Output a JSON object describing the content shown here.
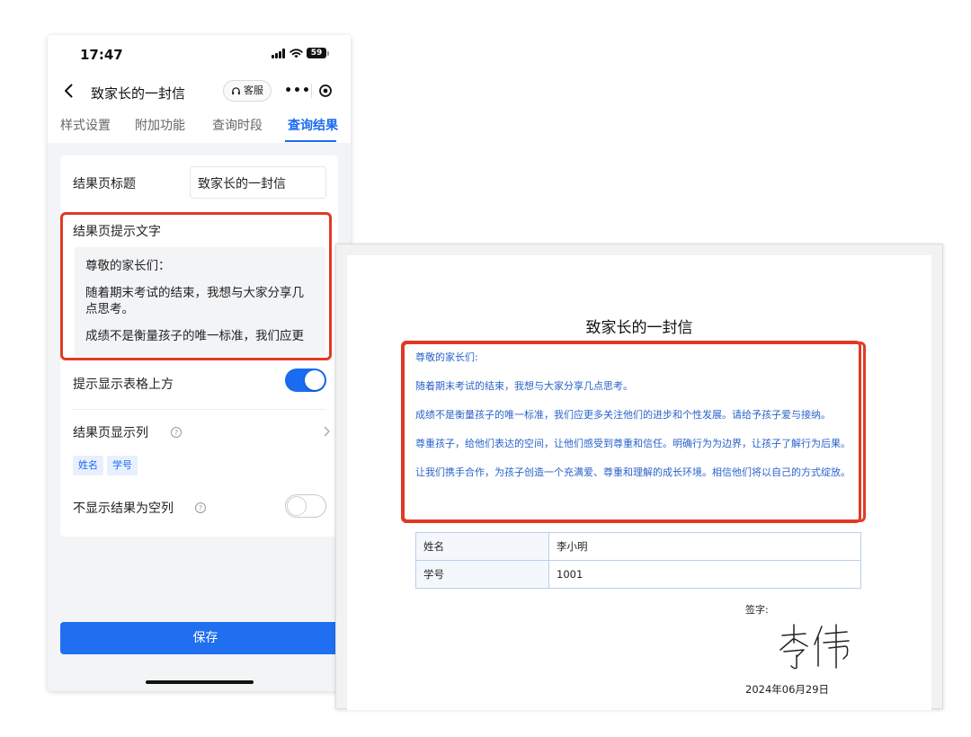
{
  "status_bar": {
    "time": "17:47",
    "battery": "59"
  },
  "nav": {
    "title": "致家长的一封信",
    "service_label": "客服",
    "more_label": "•••"
  },
  "tabs": [
    {
      "label": "样式设置",
      "active": false
    },
    {
      "label": "附加功能",
      "active": false
    },
    {
      "label": "查询时段",
      "active": false
    },
    {
      "label": "查询结果",
      "active": true
    }
  ],
  "form": {
    "result_title_label": "结果页标题",
    "result_title_value": "致家长的一封信",
    "tip_text_label": "结果页提示文字",
    "tip_text_paragraphs": [
      "尊敬的家长们：",
      "随着期末考试的结束，我想与大家分享几点思考。",
      "成绩不是衡量孩子的唯一标准，我们应更"
    ],
    "show_above_label": "提示显示表格上方",
    "show_above_on": true,
    "columns_label": "结果页显示列",
    "columns_tags": [
      "姓名",
      "学号"
    ],
    "hide_empty_label": "不显示结果为空列",
    "hide_empty_on": false,
    "help_glyph": "?",
    "save_label": "保存"
  },
  "document": {
    "title": "致家长的一封信",
    "paragraphs": [
      "尊敬的家长们:",
      "随着期末考试的结束，我想与大家分享几点思考。",
      "成绩不是衡量孩子的唯一标准，我们应更多关注他们的进步和个性发展。请给予孩子爱与接纳。",
      "尊重孩子，给他们表达的空间，让他们感受到尊重和信任。明确行为为边界，让孩子了解行为后果。",
      "让我们携手合作，为孩子创造一个充满爱、尊重和理解的成长环境。相信他们将以自己的方式绽放。"
    ],
    "table": [
      {
        "key": "姓名",
        "value": "李小明"
      },
      {
        "key": "学号",
        "value": "1001"
      }
    ],
    "sign_label": "签字:",
    "signature": "李伟",
    "date": "2024年06月29日"
  },
  "colors": {
    "accent": "#1a6bf0",
    "highlight": "#e03a26",
    "doc_text": "#2b63c9"
  }
}
